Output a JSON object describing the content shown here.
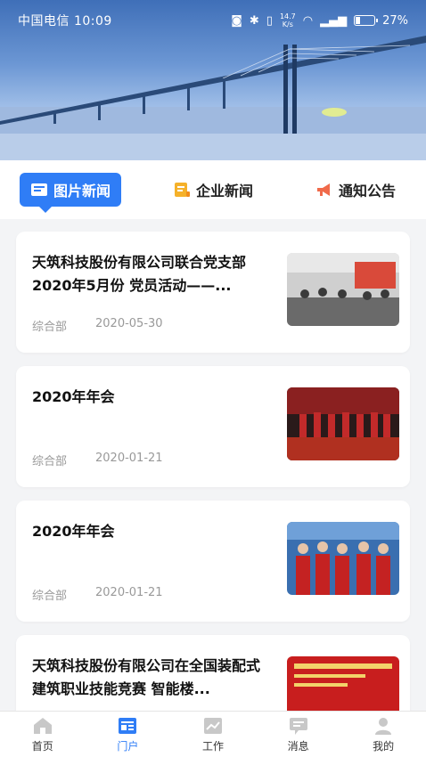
{
  "status_bar": {
    "carrier_time": "中国电信 10:09",
    "speed_top": "14.7",
    "speed_unit": "K/s",
    "battery": "27%",
    "battery_level": 0.27,
    "icons": [
      "nfc-icon",
      "bluetooth-icon",
      "vibrate-icon",
      "wifi-icon",
      "signal-icon",
      "battery-icon"
    ]
  },
  "tabs": [
    {
      "label": "图片新闻",
      "icon": "picture-news-icon",
      "active": true
    },
    {
      "label": "企业新闻",
      "icon": "company-news-icon",
      "active": false
    },
    {
      "label": "通知公告",
      "icon": "megaphone-icon",
      "active": false
    }
  ],
  "news": [
    {
      "title": "天筑科技股份有限公司联合党支部2020年5月份 党员活动——...",
      "dept": "综合部",
      "date": "2020-05-30"
    },
    {
      "title": "2020年年会",
      "dept": "综合部",
      "date": "2020-01-21"
    },
    {
      "title": "2020年年会",
      "dept": "综合部",
      "date": "2020-01-21"
    },
    {
      "title": "天筑科技股份有限公司在全国装配式建筑职业技能竞赛 智能楼...",
      "dept": "",
      "date": ""
    }
  ],
  "bottom_nav": [
    {
      "label": "首页",
      "icon": "home-icon",
      "active": false
    },
    {
      "label": "门户",
      "icon": "portal-icon",
      "active": true
    },
    {
      "label": "工作",
      "icon": "work-icon",
      "active": false
    },
    {
      "label": "消息",
      "icon": "message-icon",
      "active": false
    },
    {
      "label": "我的",
      "icon": "profile-icon",
      "active": false
    }
  ],
  "colors": {
    "accent": "#2f7df6",
    "card_bg": "#ffffff",
    "page_bg": "#f3f4f6"
  }
}
